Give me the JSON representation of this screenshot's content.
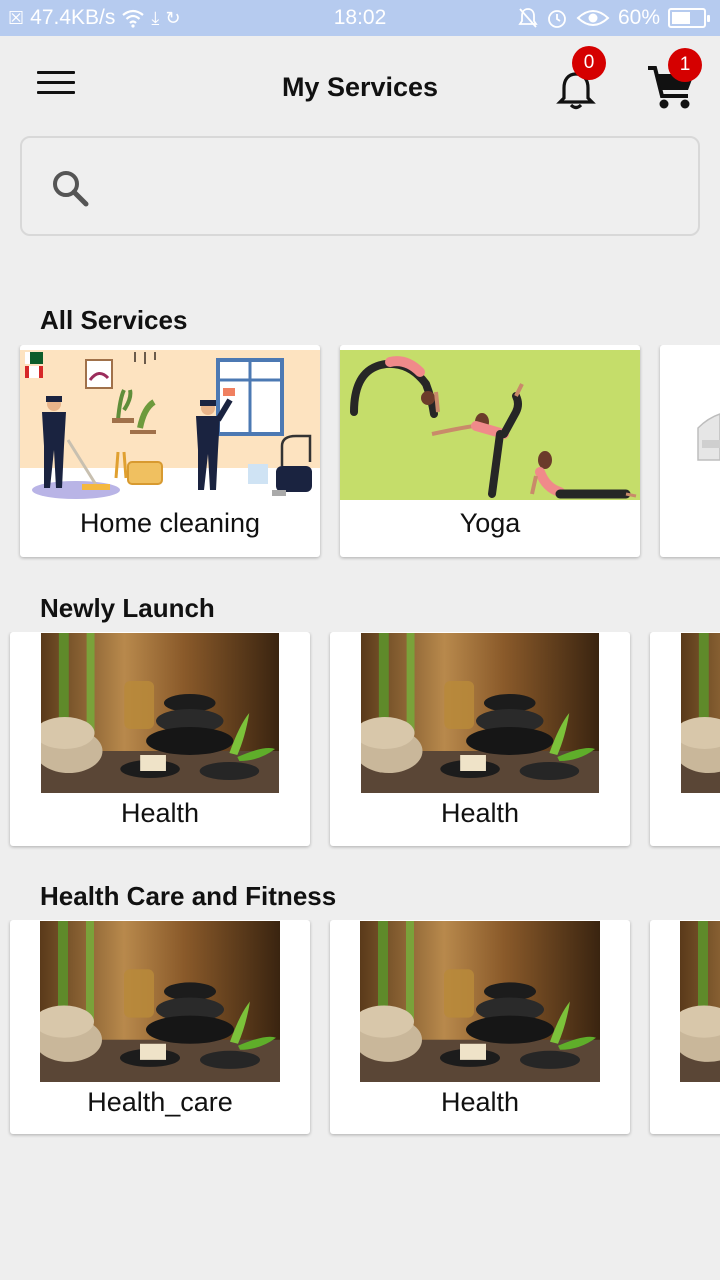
{
  "status_bar": {
    "speed": "47.4KB/s",
    "time": "18:02",
    "battery": "60%",
    "battery_level": 0.6
  },
  "app_bar": {
    "title": "My Services",
    "notification_count": "0",
    "cart_count": "1"
  },
  "search": {
    "placeholder": ""
  },
  "sections": {
    "all_services": {
      "title": "All Services",
      "cards": [
        {
          "label": "Home cleaning",
          "image": "home-cleaning-illustration"
        },
        {
          "label": "Yoga",
          "image": "yoga-illustration"
        }
      ]
    },
    "newly_launch": {
      "title": "Newly Launch",
      "cards": [
        {
          "label": "Health",
          "image": "spa-stones-photo"
        },
        {
          "label": "Health",
          "image": "spa-stones-photo"
        }
      ]
    },
    "health_care_fitness": {
      "title": "Health Care and Fitness",
      "cards": [
        {
          "label": "Health_care",
          "image": "spa-stones-photo"
        },
        {
          "label": "Health",
          "image": "spa-stones-photo"
        }
      ]
    }
  },
  "colors": {
    "badge": "#d50000",
    "status_bar": "#b6cbef",
    "yoga_bg": "#c5dd6a",
    "cleaning_bg": "#fde3c0"
  }
}
